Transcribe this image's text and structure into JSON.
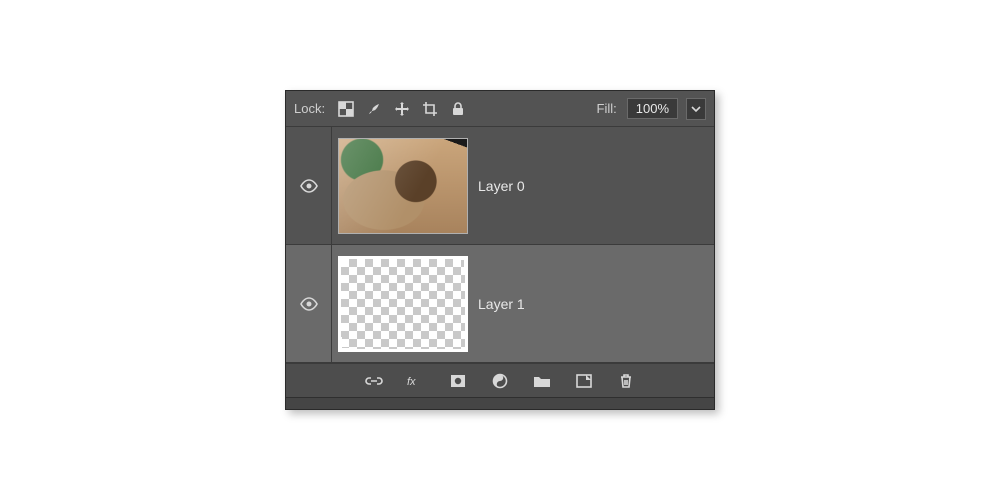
{
  "lock": {
    "label": "Lock:"
  },
  "fill": {
    "label": "Fill:",
    "value": "100%"
  },
  "layers": [
    {
      "name": "Layer 0",
      "visible": true,
      "selected": false,
      "thumb": "image"
    },
    {
      "name": "Layer 1",
      "visible": true,
      "selected": true,
      "thumb": "transparent"
    }
  ]
}
